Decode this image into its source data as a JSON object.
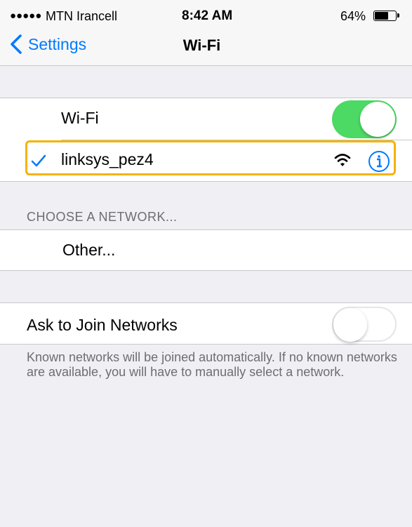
{
  "status_bar": {
    "signal": "●●●●●",
    "carrier": "MTN Irancell",
    "time": "8:42 AM",
    "battery_percent": "64%",
    "battery_level": 0.64
  },
  "nav": {
    "back_label": "Settings",
    "title": "Wi-Fi"
  },
  "wifi": {
    "label": "Wi-Fi",
    "enabled": true,
    "toggle_color": "#4cd964"
  },
  "connected_network": {
    "checkmark": "✓",
    "name": "linksys_pez4",
    "signal_icon": "wifi-signal-icon",
    "info_icon": "info-icon"
  },
  "choose_network": {
    "header": "CHOOSE A NETWORK...",
    "other_label": "Other..."
  },
  "ask_to_join": {
    "label": "Ask to Join Networks",
    "enabled": false,
    "description": "Known networks will be joined automatically. If no known networks are available, you will have to manually select a network."
  },
  "colors": {
    "accent": "#007aff",
    "highlight": "#f5b300",
    "background": "#efeff4"
  }
}
